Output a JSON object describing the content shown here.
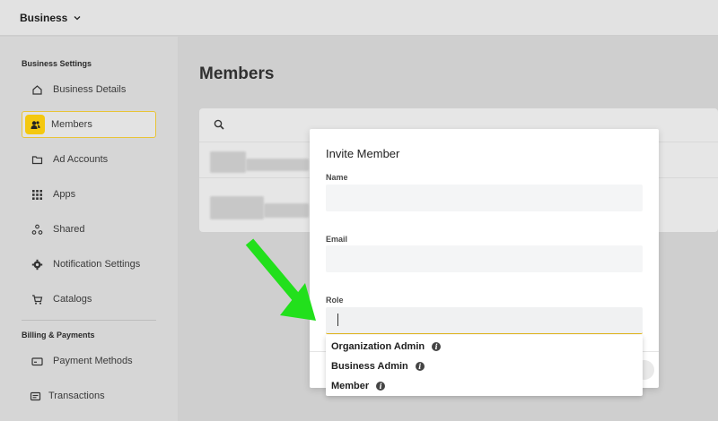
{
  "topbar": {
    "business_label": "Business"
  },
  "sidebar": {
    "business_settings_title": "Business Settings",
    "items": [
      {
        "label": "Business Details",
        "icon": "home-icon"
      },
      {
        "label": "Members",
        "icon": "members-icon"
      },
      {
        "label": "Ad Accounts",
        "icon": "folder-icon"
      },
      {
        "label": "Apps",
        "icon": "grid-icon"
      },
      {
        "label": "Shared",
        "icon": "share-icon"
      },
      {
        "label": "Notification Settings",
        "icon": "gear-icon"
      },
      {
        "label": "Catalogs",
        "icon": "cart-icon"
      }
    ],
    "billing_title": "Billing & Payments",
    "billing_items": [
      {
        "label": "Payment Methods",
        "icon": "card-icon"
      },
      {
        "label": "Transactions",
        "icon": "receipt-icon"
      }
    ]
  },
  "main": {
    "title": "Members"
  },
  "modal": {
    "title": "Invite Member",
    "name_label": "Name",
    "email_label": "Email",
    "role_label": "Role",
    "role_options": [
      "Organization Admin",
      "Business Admin",
      "Member"
    ]
  },
  "colors": {
    "accent": "#f4c80f",
    "arrow": "#22e01c"
  }
}
